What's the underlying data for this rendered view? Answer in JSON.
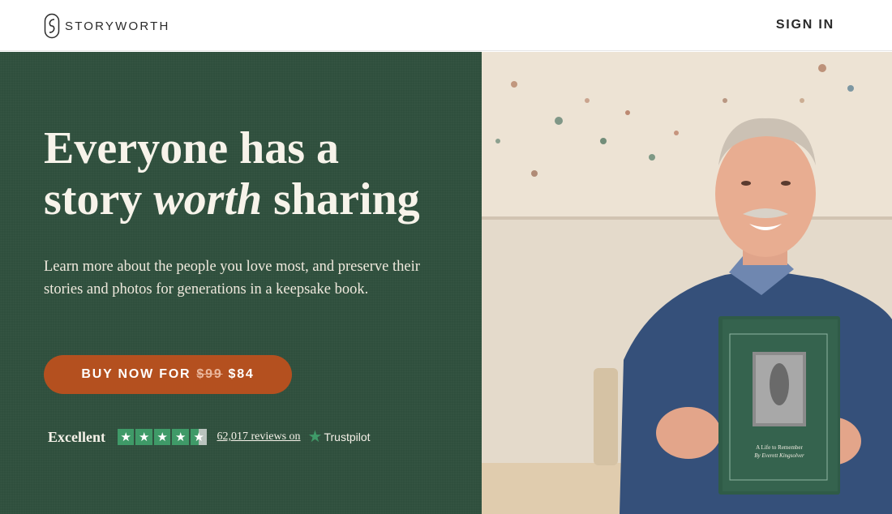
{
  "header": {
    "brand": "STORYWORTH",
    "sign_in": "SIGN IN"
  },
  "hero": {
    "headline_line1": "Everyone has a",
    "headline_pre": "story ",
    "headline_em": "worth",
    "headline_post": " sharing",
    "subcopy": "Learn more about the people you love most, and preserve their stories and photos for generations in a keepsake book.",
    "cta": {
      "label": "BUY NOW FOR",
      "old_price": "$99",
      "price": "$84"
    },
    "trust": {
      "rating_word": "Excellent",
      "stars": 4.5,
      "reviews_text": "62,017 reviews on",
      "provider": "Trustpilot"
    }
  },
  "photo": {
    "book_title": "A Life to Remember",
    "book_author": "By Everett Kingsolver"
  },
  "colors": {
    "hero_green": "#2f4f3d",
    "cta_orange": "#b4501f",
    "trustpilot_green": "#3f9a68"
  }
}
